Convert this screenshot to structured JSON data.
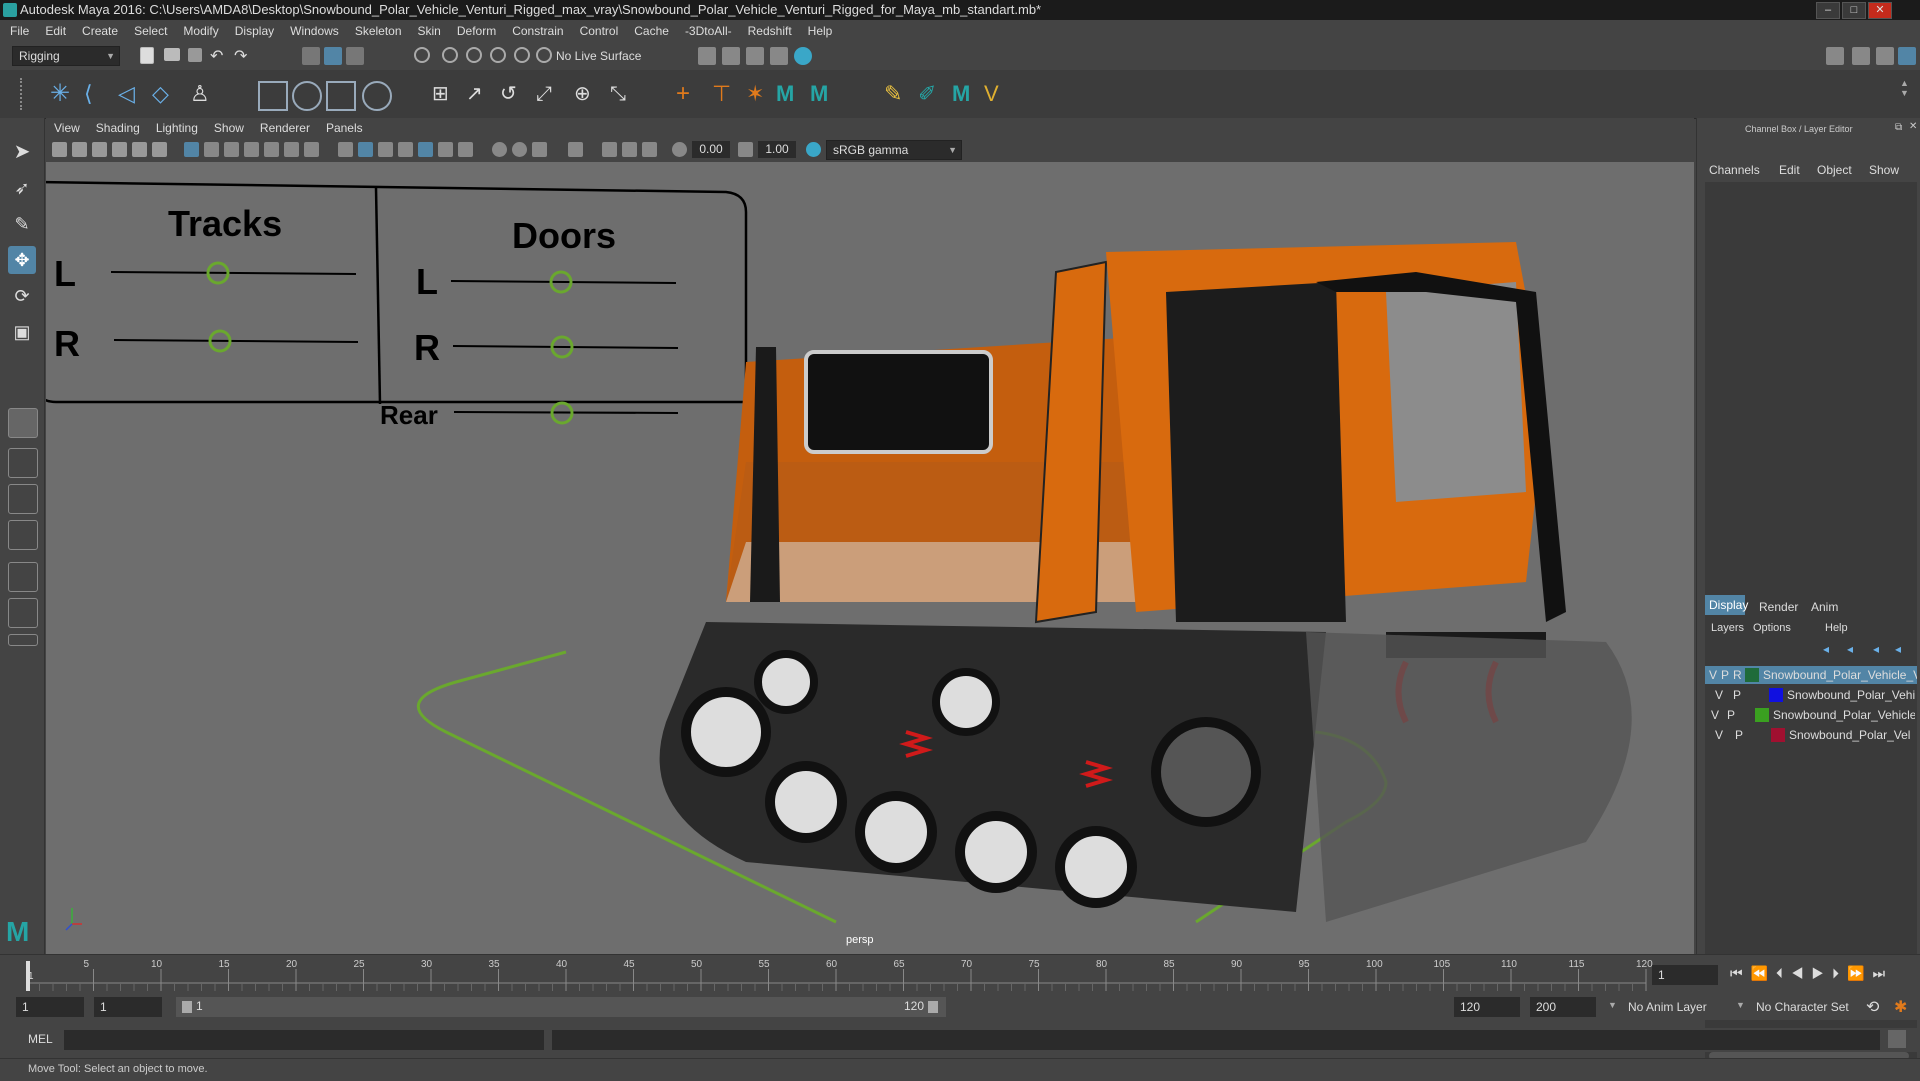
{
  "window": {
    "title": "Autodesk Maya 2016: C:\\Users\\AMDA8\\Desktop\\Snowbound_Polar_Vehicle_Venturi_Rigged_max_vray\\Snowbound_Polar_Vehicle_Venturi_Rigged_for_Maya_mb_standart.mb*",
    "minimize": "–",
    "maximize": "□",
    "close": "✕"
  },
  "menubar": [
    "File",
    "Edit",
    "Create",
    "Select",
    "Modify",
    "Display",
    "Windows",
    "Skeleton",
    "Skin",
    "Deform",
    "Constrain",
    "Control",
    "Cache",
    "-3DtoAll-",
    "Redshift",
    "Help"
  ],
  "toolbar": {
    "mode": "Rigging",
    "live_surface": "No Live Surface"
  },
  "viewport": {
    "menu": [
      "View",
      "Shading",
      "Lighting",
      "Show",
      "Renderer",
      "Panels"
    ],
    "exposure": "0.00",
    "gamma": "1.00",
    "color_space": "sRGB gamma",
    "camera_label": "persp"
  },
  "control_panel": {
    "tracks_title": "Tracks",
    "doors_title": "Doors",
    "tracks_left": "L",
    "tracks_right": "R",
    "doors_left": "L",
    "doors_right": "R",
    "doors_rear": "Rear"
  },
  "channel_box": {
    "title": "Channel Box / Layer Editor",
    "menu": [
      "Channels",
      "Edit",
      "Object",
      "Show"
    ],
    "tabs": [
      "Display",
      "Render",
      "Anim"
    ],
    "layer_menu": [
      "Layers",
      "Options",
      "Help"
    ],
    "layers": [
      {
        "v": "V",
        "p": "P",
        "r": "R",
        "color": "#1f6b3a",
        "name": "Snowbound_Polar_Vehicle_V",
        "selected": true
      },
      {
        "v": "V",
        "p": "P",
        "r": "",
        "color": "#1010e0",
        "name": "Snowbound_Polar_Vehi",
        "selected": false
      },
      {
        "v": "V",
        "p": "P",
        "r": "",
        "color": "#3aa020",
        "name": "Snowbound_Polar_Vehicle",
        "selected": false
      },
      {
        "v": "V",
        "p": "P",
        "r": "",
        "color": "#a01030",
        "name": "Snowbound_Polar_Vel",
        "selected": false
      }
    ]
  },
  "timeline": {
    "ticks": [
      "5",
      "10",
      "15",
      "20",
      "25",
      "30",
      "35",
      "40",
      "45",
      "50",
      "55",
      "60",
      "65",
      "70",
      "75",
      "80",
      "85",
      "90",
      "95",
      "100",
      "105",
      "110",
      "115",
      "120"
    ],
    "start_tick": "1",
    "current_frame": "1"
  },
  "range": {
    "start": "1",
    "playback_start": "1",
    "slider_start": "1",
    "slider_end": "120",
    "playback_end": "120",
    "end": "200",
    "anim_layer": "No Anim Layer",
    "character_set": "No Character Set"
  },
  "mel": {
    "label": "MEL"
  },
  "status": {
    "text": "Move Tool: Select an object to move."
  },
  "colors": {
    "accent": "#5285a6",
    "rig_green": "#6aa82e",
    "vehicle_orange": "#d86a0e"
  }
}
